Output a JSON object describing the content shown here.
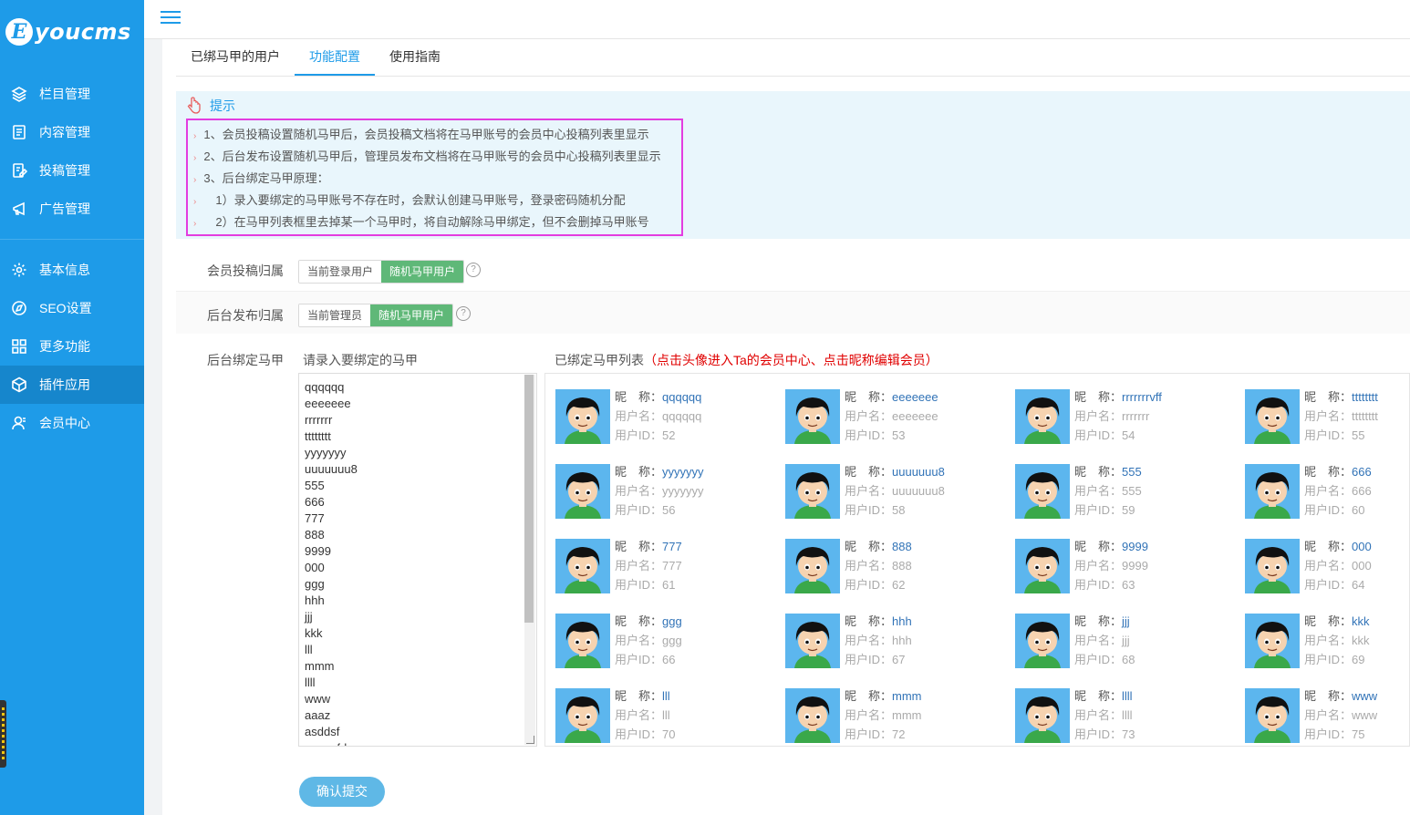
{
  "app": {
    "logo_letter": "E",
    "logo_text": "youcms"
  },
  "sidebar": {
    "groups": [
      [
        {
          "label": "栏目管理",
          "icon": "layers-icon"
        },
        {
          "label": "内容管理",
          "icon": "document-icon"
        },
        {
          "label": "投稿管理",
          "icon": "edit-document-icon"
        },
        {
          "label": "广告管理",
          "icon": "megaphone-icon"
        }
      ],
      [
        {
          "label": "基本信息",
          "icon": "gear-icon"
        },
        {
          "label": "SEO设置",
          "icon": "compass-icon"
        },
        {
          "label": "更多功能",
          "icon": "grid-icon"
        },
        {
          "label": "插件应用",
          "icon": "cube-icon",
          "active": true
        },
        {
          "label": "会员中心",
          "icon": "user-icon"
        }
      ]
    ]
  },
  "tabs": [
    {
      "label": "已绑马甲的用户"
    },
    {
      "label": "功能配置",
      "active": true
    },
    {
      "label": "使用指南"
    }
  ],
  "tips": {
    "title": "提示",
    "lines": [
      "1、会员投稿设置随机马甲后，会员投稿文档将在马甲账号的会员中心投稿列表里显示",
      "2、后台发布设置随机马甲后，管理员发布文档将在马甲账号的会员中心投稿列表里显示",
      "3、后台绑定马甲原理：",
      "　1）录入要绑定的马甲账号不存在时，会默认创建马甲账号，登录密码随机分配",
      "　2）在马甲列表框里去掉某一个马甲时，将自动解除马甲绑定，但不会删掉马甲账号"
    ]
  },
  "member_post": {
    "label": "会员投稿归属",
    "options": [
      "当前登录用户",
      "随机马甲用户"
    ],
    "selected": 1
  },
  "admin_post": {
    "label": "后台发布归属",
    "options": [
      "当前管理员",
      "随机马甲用户"
    ],
    "selected": 1
  },
  "bind": {
    "label": "后台绑定马甲",
    "input_title": "请录入要绑定的马甲",
    "list_title": "已绑定马甲列表",
    "list_hint": "（点击头像进入Ta的会员中心、点击昵称编辑会员）",
    "textarea_lines": [
      "qqqqqq",
      "eeeeeee",
      "rrrrrrr",
      "tttttttt",
      "yyyyyyy",
      "uuuuuuu8",
      "555",
      "666",
      "777",
      "888",
      "9999",
      "000",
      "ggg",
      "hhh",
      "jjj",
      "kkk",
      "lll",
      "mmm",
      "llll",
      "www",
      "aaaz",
      "asddsf",
      "qqqqsfdg"
    ],
    "nick_label": "昵　称：",
    "user_label": "用户名：",
    "id_label": "用户ID：",
    "users": [
      {
        "nick": "qqqqqq",
        "username": "qqqqqq",
        "id": "52"
      },
      {
        "nick": "eeeeeee",
        "username": "eeeeeee",
        "id": "53"
      },
      {
        "nick": "rrrrrrrvff",
        "username": "rrrrrrr",
        "id": "54"
      },
      {
        "nick": "tttttttt",
        "username": "tttttttt",
        "id": "55"
      },
      {
        "nick": "yyyyyyy",
        "username": "yyyyyyy",
        "id": "56"
      },
      {
        "nick": "uuuuuuu8",
        "username": "uuuuuuu8",
        "id": "58"
      },
      {
        "nick": "555",
        "username": "555",
        "id": "59"
      },
      {
        "nick": "666",
        "username": "666",
        "id": "60"
      },
      {
        "nick": "777",
        "username": "777",
        "id": "61"
      },
      {
        "nick": "888",
        "username": "888",
        "id": "62"
      },
      {
        "nick": "9999",
        "username": "9999",
        "id": "63"
      },
      {
        "nick": "000",
        "username": "000",
        "id": "64"
      },
      {
        "nick": "ggg",
        "username": "ggg",
        "id": "66"
      },
      {
        "nick": "hhh",
        "username": "hhh",
        "id": "67"
      },
      {
        "nick": "jjj",
        "username": "jjj",
        "id": "68"
      },
      {
        "nick": "kkk",
        "username": "kkk",
        "id": "69"
      },
      {
        "nick": "lll",
        "username": "lll",
        "id": "70"
      },
      {
        "nick": "mmm",
        "username": "mmm",
        "id": "72"
      },
      {
        "nick": "llll",
        "username": "llll",
        "id": "73"
      },
      {
        "nick": "www",
        "username": "www",
        "id": "75"
      }
    ]
  },
  "submit_label": "确认提交",
  "colors": {
    "sidebar": "#1e9be8",
    "accent": "#1e9be8",
    "toggle_on": "#5fb878",
    "hint_red": "#e00000",
    "highlight_border": "#e33de0",
    "submit": "#5fb8e6"
  }
}
